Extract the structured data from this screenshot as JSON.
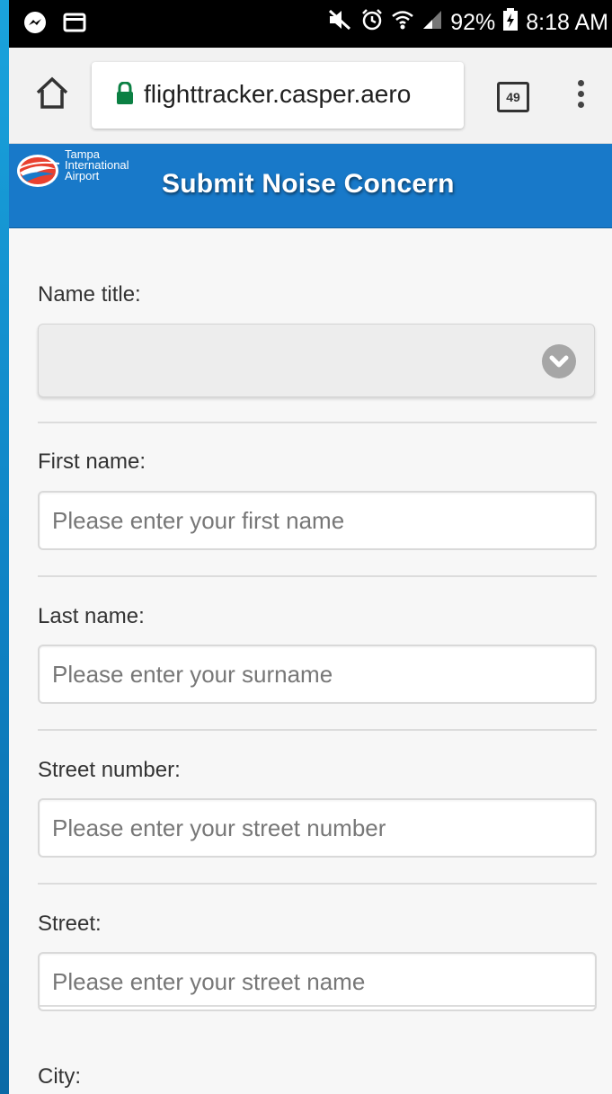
{
  "status_bar": {
    "battery": "92%",
    "time": "8:18 AM"
  },
  "browser": {
    "url": "flighttracker.casper.aero",
    "tab_count": "49"
  },
  "header": {
    "logo_lines": [
      "Tampa",
      "International",
      "Airport"
    ],
    "title": "Submit Noise Concern"
  },
  "form": {
    "name_title_label": "Name title:",
    "name_title_value": "",
    "first_name_label": "First name:",
    "first_name_placeholder": "Please enter your first name",
    "last_name_label": "Last name:",
    "last_name_placeholder": "Please enter your surname",
    "street_number_label": "Street number:",
    "street_number_placeholder": "Please enter your street number",
    "street_label": "Street:",
    "street_placeholder": "Please enter your street name",
    "city_label": "City:"
  },
  "colors": {
    "header_blue": "#1879c9",
    "lock_green": "#0b8043"
  }
}
